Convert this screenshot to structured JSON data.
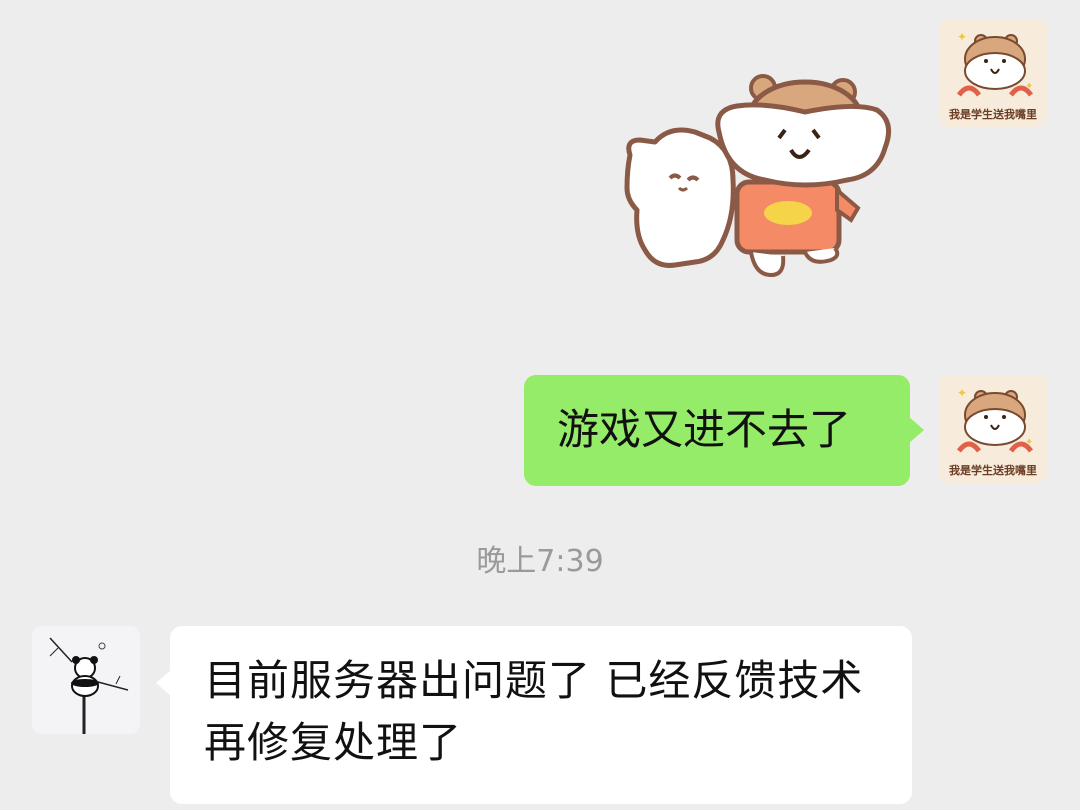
{
  "chat": {
    "messages": [
      {
        "id": "msg-1",
        "side": "right",
        "type": "sticker",
        "sticker_name": "hamster-and-cat-sticker"
      },
      {
        "id": "msg-2",
        "side": "right",
        "type": "text",
        "text": "游戏又进不去了"
      },
      {
        "id": "msg-3",
        "side": "left",
        "type": "text",
        "text": "目前服务器出问题了 已经反馈技术再修复处理了"
      }
    ],
    "timestamp": "晚上7:39"
  },
  "avatars": {
    "me": {
      "caption": "我是学生送我嘴里",
      "icon": "hamster-avatar-icon"
    },
    "other": {
      "icon": "panda-ink-avatar-icon"
    }
  },
  "colors": {
    "background": "#ededed",
    "outgoing_bubble": "#95ec69",
    "incoming_bubble": "#ffffff",
    "timestamp_text": "#9a9a9a"
  }
}
